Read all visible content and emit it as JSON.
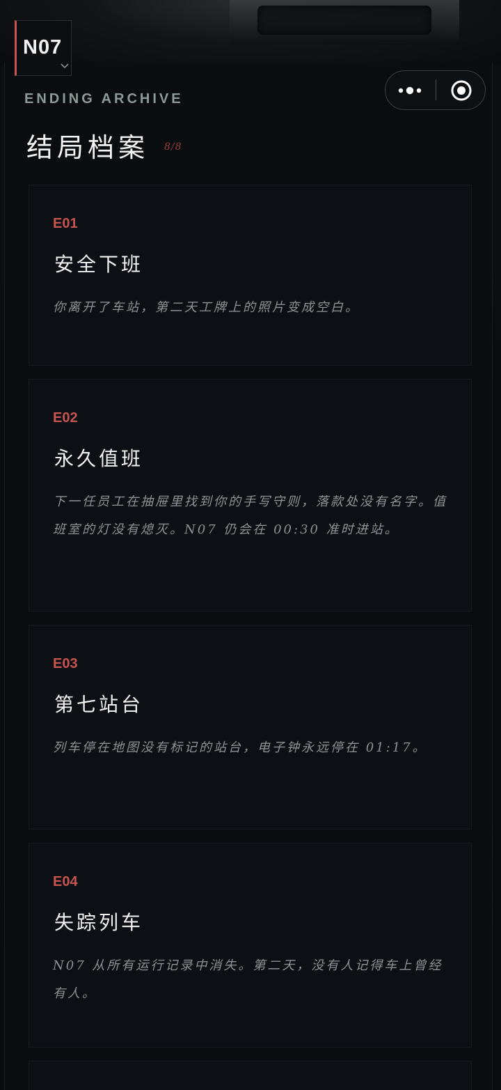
{
  "header": {
    "badge": "N07",
    "overline": "ENDING ARCHIVE",
    "title": "结局档案",
    "count": "8/8"
  },
  "capsule": {
    "more_icon": "more-dots-icon",
    "close_icon": "target-circle-icon"
  },
  "colors": {
    "accent_red": "#c65450",
    "background": "#0a0d10",
    "card": "#0c1014"
  },
  "endings": [
    {
      "code": "E01",
      "title": "安全下班",
      "desc": "你离开了车站，第二天工牌上的照片变成空白。"
    },
    {
      "code": "E02",
      "title": "永久值班",
      "desc": "下一任员工在抽屉里找到你的手写守则，落款处没有名字。值班室的灯没有熄灭。N07 仍会在 00:30 准时进站。"
    },
    {
      "code": "E03",
      "title": "第七站台",
      "desc": "列车停在地图没有标记的站台，电子钟永远停在 01:17。"
    },
    {
      "code": "E04",
      "title": "失踪列车",
      "desc": "N07 从所有运行记录中消失。第二天，没有人记得车上曾经有人。"
    }
  ]
}
